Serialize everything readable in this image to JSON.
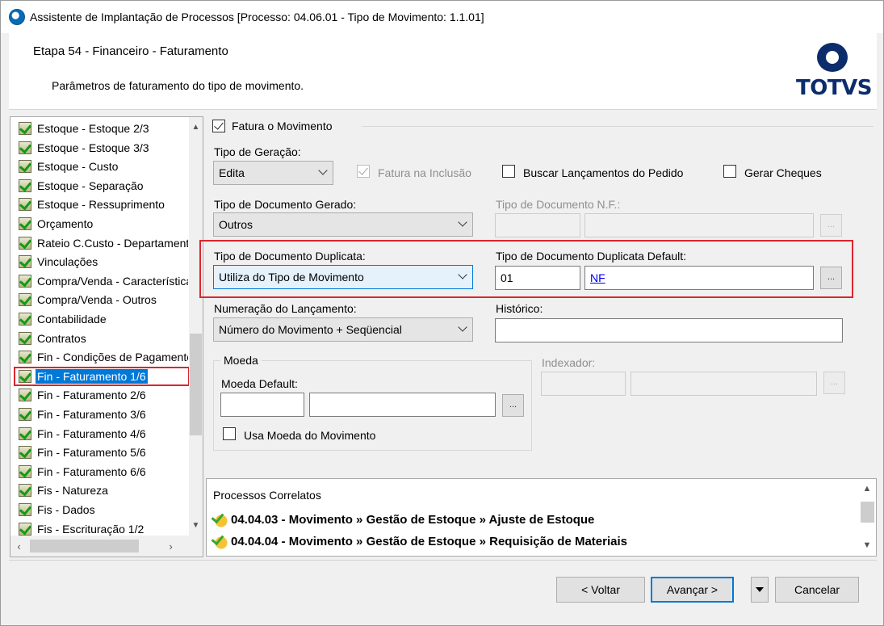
{
  "window": {
    "title": "Assistente de Implantação de Processos [Processo: 04.06.01 - Tipo de Movimento: 1.1.01]"
  },
  "header": {
    "step_title": "Etapa 54 - Financeiro - Faturamento",
    "description": "Parâmetros de faturamento do tipo de movimento.",
    "logo_text": "TOTVS"
  },
  "tree": {
    "items": [
      {
        "label": "Estoque - Estoque 2/3"
      },
      {
        "label": "Estoque - Estoque 3/3"
      },
      {
        "label": "Estoque - Custo"
      },
      {
        "label": "Estoque - Separação"
      },
      {
        "label": "Estoque - Ressuprimento"
      },
      {
        "label": "Orçamento"
      },
      {
        "label": "Rateio C.Custo - Departamento"
      },
      {
        "label": "Vinculações"
      },
      {
        "label": "Compra/Venda - Características"
      },
      {
        "label": "Compra/Venda - Outros"
      },
      {
        "label": "Contabilidade"
      },
      {
        "label": "Contratos"
      },
      {
        "label": "Fin - Condições de Pagamento"
      },
      {
        "label": "Fin - Faturamento 1/6"
      },
      {
        "label": "Fin - Faturamento 2/6"
      },
      {
        "label": "Fin - Faturamento 3/6"
      },
      {
        "label": "Fin - Faturamento 4/6"
      },
      {
        "label": "Fin - Faturamento 5/6"
      },
      {
        "label": "Fin - Faturamento 6/6"
      },
      {
        "label": "Fis - Natureza"
      },
      {
        "label": "Fis - Dados"
      },
      {
        "label": "Fis - Escrituração 1/2"
      }
    ],
    "selected_index": 13
  },
  "form": {
    "fatura_movimento": {
      "label": "Fatura o Movimento",
      "checked": true
    },
    "tipo_geracao": {
      "label": "Tipo de Geração:",
      "value": "Edita"
    },
    "fatura_inclusao": {
      "label": "Fatura na Inclusão",
      "checked": true,
      "enabled": false
    },
    "buscar_lancamentos": {
      "label": "Buscar Lançamentos do Pedido",
      "checked": false
    },
    "gerar_cheques": {
      "label": "Gerar Cheques",
      "checked": false
    },
    "tipo_documento_gerado": {
      "label": "Tipo de Documento Gerado:",
      "value": "Outros"
    },
    "tipo_documento_nf": {
      "label": "Tipo de Documento N.F.:",
      "code": "",
      "desc": ""
    },
    "tipo_documento_duplicata": {
      "label": "Tipo de Documento Duplicata:",
      "value": "Utiliza do Tipo de Movimento"
    },
    "tipo_documento_duplicata_default": {
      "label": "Tipo de Documento Duplicata Default:",
      "code": "01",
      "desc": "NF"
    },
    "numeracao_lancamento": {
      "label": "Numeração do Lançamento:",
      "value": "Número do Movimento + Seqüencial"
    },
    "historico": {
      "label": "Histórico:",
      "value": ""
    },
    "moeda": {
      "group_label": "Moeda",
      "default_label": "Moeda Default:",
      "code": "",
      "desc": ""
    },
    "usa_moeda_movimento": {
      "label": "Usa Moeda do Movimento",
      "checked": false
    },
    "indexador": {
      "label": "Indexador:",
      "code": "",
      "desc": ""
    },
    "lookup_label": "..."
  },
  "related": {
    "title": "Processos Correlatos",
    "items": [
      {
        "label": "04.04.03 - Movimento » Gestão de Estoque » Ajuste de Estoque"
      },
      {
        "label": "04.04.04 - Movimento » Gestão de Estoque » Requisição de Materiais"
      }
    ]
  },
  "footer": {
    "back_label": "< Voltar",
    "next_label": "Avançar >",
    "cancel_label": "Cancelar"
  },
  "colors": {
    "selection": "#0078d7",
    "highlight_box": "#d9262e",
    "logo": "#0c2c6c"
  }
}
